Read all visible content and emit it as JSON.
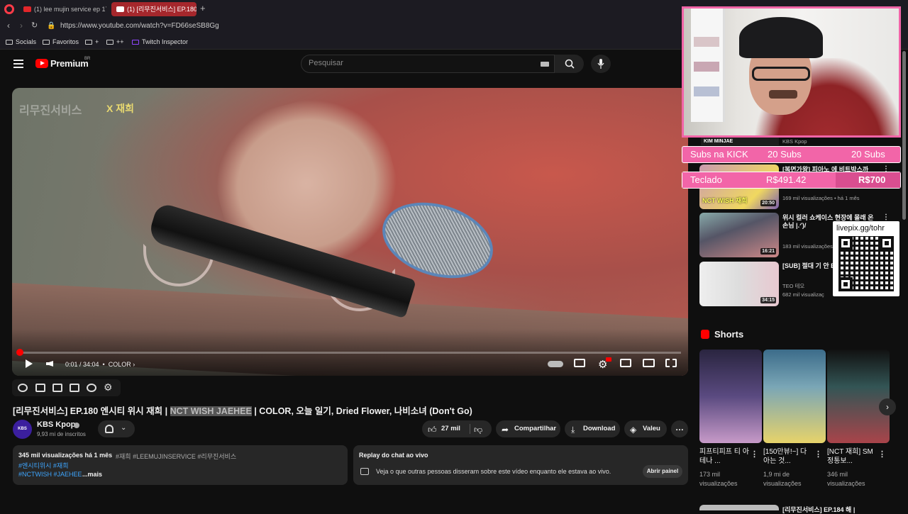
{
  "browser": {
    "tabs": [
      {
        "label": "(1) lee mujin service ep 17"
      },
      {
        "label": "(1) [리무진서비스] EP.180"
      }
    ],
    "new_tab": "+",
    "url": "https://www.youtube.com/watch?v=FD66seSB8Gg",
    "bookmarks": [
      "Socials",
      "Favoritos",
      "+",
      "++",
      "Twitch Inspector"
    ]
  },
  "yt": {
    "brand": "Premium",
    "region": "BR",
    "search_placeholder": "Pesquisar"
  },
  "player": {
    "watermark_left": "리무진서비스",
    "watermark_right": "X 재희",
    "time": "0:01 / 34:04",
    "chapter": "COLOR",
    "progress_fraction": 0.0005
  },
  "video": {
    "title_before": "[리무진서비스] EP.180 엔시티 위시 재희 | ",
    "title_highlight": "NCT WISH JAEHEE",
    "title_after": " | COLOR, 오늘 일기, Dried Flower, 나비소녀 (Don't Go)",
    "channel": "KBS Kpop",
    "avatar_text": "KBS Kpop",
    "subscribers": "9,93 mi de inscritos",
    "likes": "27 mil",
    "share": "Compartilhar",
    "download": "Download",
    "thanks": "Valeu",
    "more": "…"
  },
  "description": {
    "stats": "345 mil visualizações  há 1 mês",
    "tags": "#재희 #LEEMUJINSERVICE #리무진서비스",
    "line2": "#엔시티위시 #재희",
    "line3": "#NCTWISH #JAEHEE",
    "more": "...mais"
  },
  "chat_replay": {
    "title": "Replay do chat ao vivo",
    "text": "Veja o que outras pessoas disseram sobre este vídeo enquanto ele estava ao vivo.",
    "button": "Abrir painel"
  },
  "recommendations": [
    {
      "title": "[복면가왕] 피아노 에 비트박스까",
      "channel": "",
      "meta": "169 mil visualizações • há 1 mês",
      "duration": "20:50",
      "thumb_text": "NCT WISH 재희"
    },
    {
      "title": "위시 컬러 쇼케이스 현장에 몰래 온 손님 |.ᐟ)/",
      "channel": "",
      "meta": "183 mil visualizações",
      "duration": "16:21",
      "thumb_text": ""
    },
    {
      "title": "[SUB] 절대 기 안 EP. 87 미야오 니",
      "channel": "TEO 테오",
      "meta": "682 mil visualizaç",
      "duration": "34:15",
      "thumb_text": ""
    }
  ],
  "rec4_title": "[리무진서비스] EP.184 해 |",
  "shorts": {
    "title": "Shorts",
    "items": [
      {
        "title": "피프티피프 티 아테나 ...",
        "views": "173 mil visualizações"
      },
      {
        "title": "[150만뷰!~] 다 아는 것...",
        "views": "1,9 mi de visualizações"
      },
      {
        "title": "[NCT 재희] SM 정통보...",
        "views": "346 mil visualizações"
      }
    ]
  },
  "overlay": {
    "kim_label": "KIM MINJAE",
    "kbs_channel": "KBS Kpop",
    "subs_label": "Subs na KICK",
    "subs_current": "20 Subs",
    "subs_goal": "20 Subs",
    "teclado_label": "Teclado",
    "teclado_current": "R$491.42",
    "teclado_goal": "R$700",
    "teclado_progress": 0.702,
    "qr_label": "livepix.gg/tohr"
  },
  "colors": {
    "youtube_red": "#ff0000",
    "overlay_pink": "#f265a8",
    "tab_active": "#a5272c",
    "link_blue": "#3ea6ff"
  }
}
